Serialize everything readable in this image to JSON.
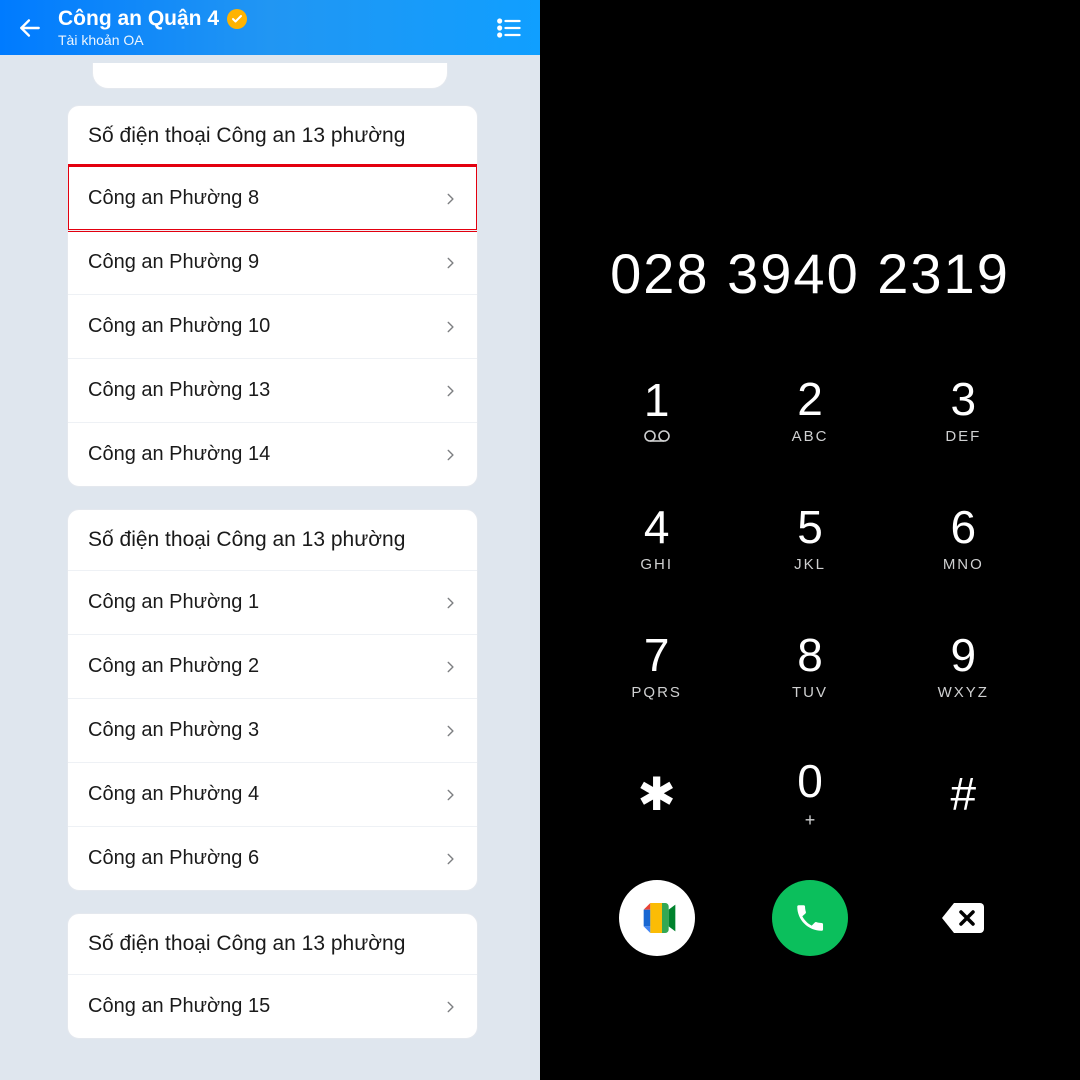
{
  "header": {
    "title": "Công an Quận 4",
    "subtitle": "Tài khoản OA",
    "verified": true
  },
  "cards": [
    {
      "title": "Số điện thoại Công an 13 phường",
      "items": [
        {
          "label": "Công an Phường 8",
          "highlight": true
        },
        {
          "label": "Công an Phường 9"
        },
        {
          "label": "Công an Phường 10"
        },
        {
          "label": "Công an Phường 13"
        },
        {
          "label": "Công an Phường 14"
        }
      ]
    },
    {
      "title": "Số điện thoại Công an 13 phường",
      "items": [
        {
          "label": "Công an Phường 1"
        },
        {
          "label": "Công an Phường 2"
        },
        {
          "label": "Công an Phường 3"
        },
        {
          "label": "Công an Phường 4"
        },
        {
          "label": "Công an Phường 6"
        }
      ]
    },
    {
      "title": "Số điện thoại Công an 13 phường",
      "items": [
        {
          "label": "Công an Phường 15"
        }
      ]
    }
  ],
  "dialer": {
    "number": "028 3940 2319",
    "keys": [
      {
        "digit": "1",
        "sub": "",
        "vm": true
      },
      {
        "digit": "2",
        "sub": "ABC"
      },
      {
        "digit": "3",
        "sub": "DEF"
      },
      {
        "digit": "4",
        "sub": "GHI"
      },
      {
        "digit": "5",
        "sub": "JKL"
      },
      {
        "digit": "6",
        "sub": "MNO"
      },
      {
        "digit": "7",
        "sub": "PQRS"
      },
      {
        "digit": "8",
        "sub": "TUV"
      },
      {
        "digit": "9",
        "sub": "WXYZ"
      },
      {
        "digit": "✱",
        "sub": "",
        "sym": true
      },
      {
        "digit": "0",
        "sub": "+",
        "plus": true
      },
      {
        "digit": "#",
        "sub": "",
        "sym": true
      }
    ]
  }
}
